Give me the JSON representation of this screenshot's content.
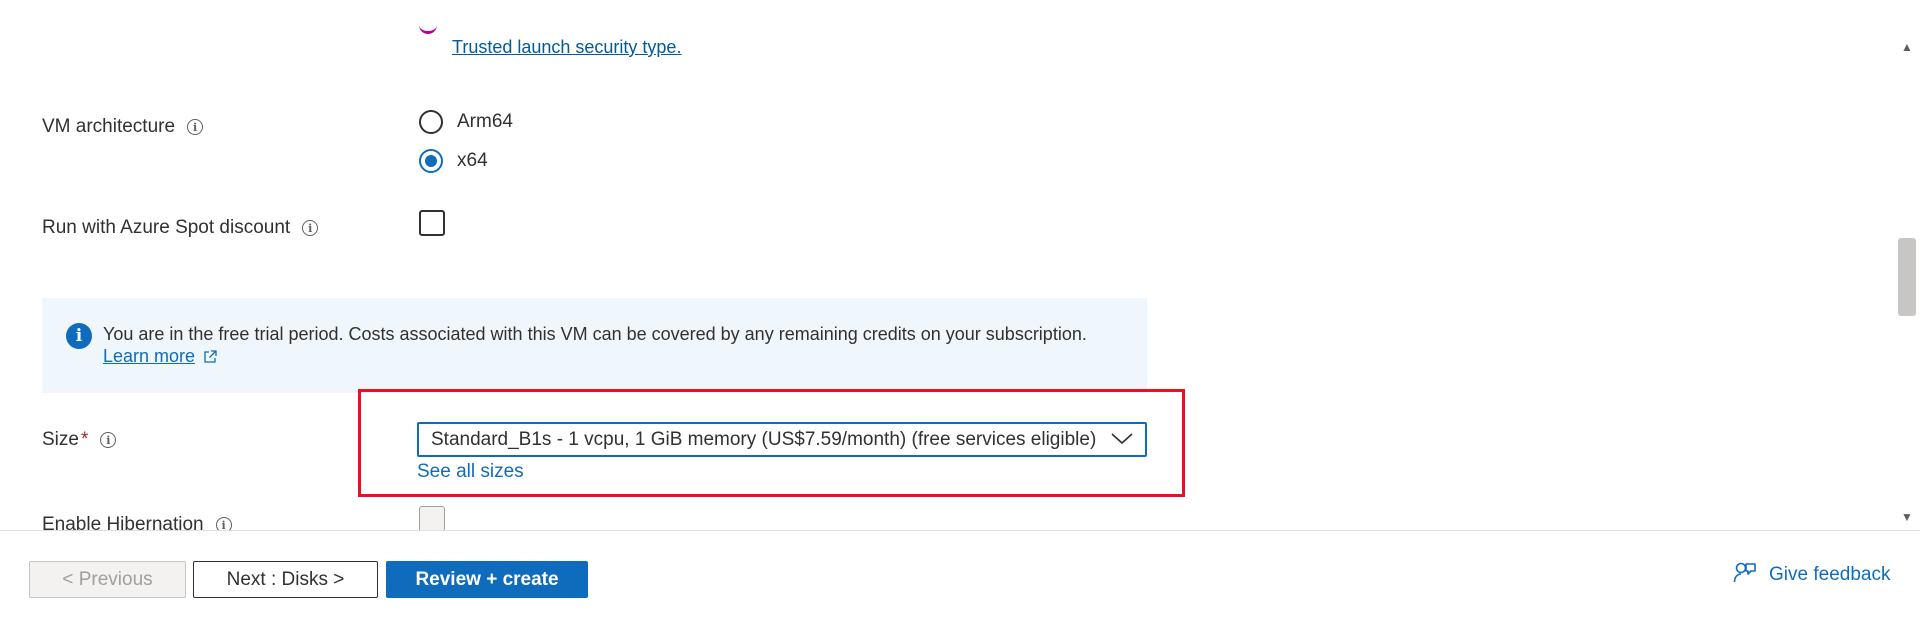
{
  "security": {
    "trusted_launch_link": "Trusted launch security type."
  },
  "vm_architecture": {
    "label": "VM architecture",
    "options": [
      {
        "label": "Arm64",
        "selected": false
      },
      {
        "label": "x64",
        "selected": true
      }
    ]
  },
  "spot_discount": {
    "label": "Run with Azure Spot discount",
    "checked": false
  },
  "info_banner": {
    "text": "You are in the free trial period. Costs associated with this VM can be covered by any remaining credits on your subscription.",
    "link": "Learn more"
  },
  "size": {
    "label": "Size",
    "required_mark": "*",
    "selected_value": "Standard_B1s - 1 vcpu, 1 GiB memory (US$7.59/month)  (free services eligible)",
    "see_all_link": "See all sizes"
  },
  "hibernation": {
    "label": "Enable Hibernation",
    "checked": false,
    "disabled": true
  },
  "footer": {
    "previous_label": "< Previous",
    "next_label": "Next : Disks >",
    "review_label": "Review + create",
    "feedback_label": "Give feedback"
  },
  "colors": {
    "accent": "#0f6cbd",
    "highlight": "#e81123",
    "banner_bg": "#eff6fc"
  }
}
